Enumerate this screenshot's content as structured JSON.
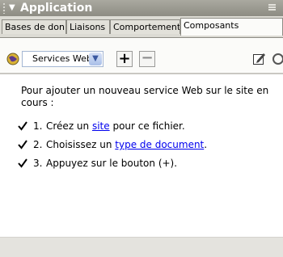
{
  "panel": {
    "title": "Application",
    "collapse_arrow": "▼"
  },
  "tabs": [
    {
      "label": "Bases de données",
      "active": false
    },
    {
      "label": "Liaisons",
      "active": false
    },
    {
      "label": "Comportements",
      "active": false
    },
    {
      "label": "Composants",
      "active": true
    }
  ],
  "toolbar": {
    "type_select_value": "Services Web",
    "add_label": "+",
    "remove_label": "−"
  },
  "content": {
    "intro": "Pour ajouter un nouveau service Web sur le site en cours :",
    "steps": [
      {
        "num": "1.",
        "before": "Créez un ",
        "link": "site",
        "after": " pour ce fichier."
      },
      {
        "num": "2.",
        "before": "Choisissez un ",
        "link": "type de document",
        "after": "."
      },
      {
        "num": "3.",
        "before": "Appuyez sur le bouton (+).",
        "link": "",
        "after": ""
      }
    ]
  },
  "colors": {
    "link": "#0000ee",
    "titlebar": "#9a998f",
    "accent_blue": "#3a58a0"
  }
}
